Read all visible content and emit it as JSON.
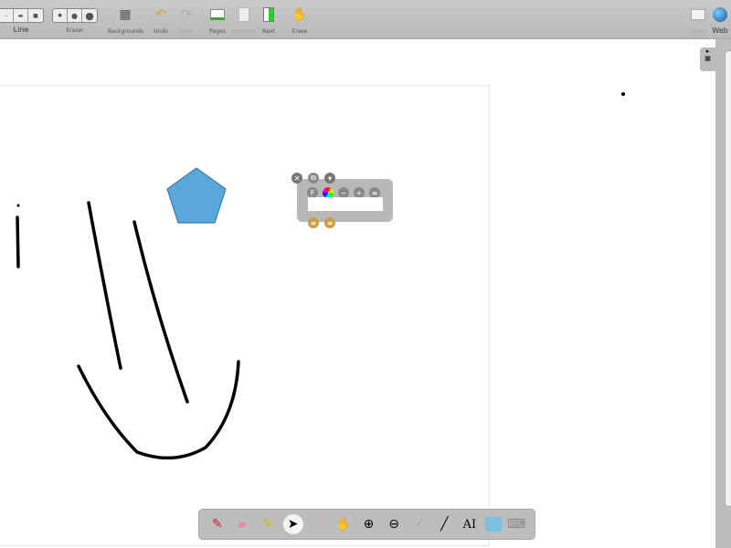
{
  "toolbar": {
    "line": {
      "label": "Line"
    },
    "eraser": {
      "label": "Eraser"
    },
    "backgrounds": {
      "label": "Backgrounds"
    },
    "undo": {
      "label": "Undo"
    },
    "redo": {
      "label": "Redo"
    },
    "pages": {
      "label": "Pages"
    },
    "previous": {
      "label": "Previous"
    },
    "next": {
      "label": "Next"
    },
    "erase": {
      "label": "Erase"
    },
    "board": {
      "label": "Board"
    },
    "web": {
      "label": "Web"
    }
  },
  "dock": {
    "tools": [
      "pen-icon",
      "eraser-icon",
      "marker-icon",
      "pointer-icon",
      "play-icon",
      "hand-icon",
      "zoom-in-icon",
      "zoom-out-icon",
      "laser-pointer-icon",
      "line-icon",
      "text-icon",
      "capture-icon",
      "keyboard-icon"
    ],
    "selected": "pointer-icon",
    "text_tool": "AI"
  },
  "colors": {
    "shape": "#5aa7dc",
    "toolbar": "#bebebe"
  }
}
